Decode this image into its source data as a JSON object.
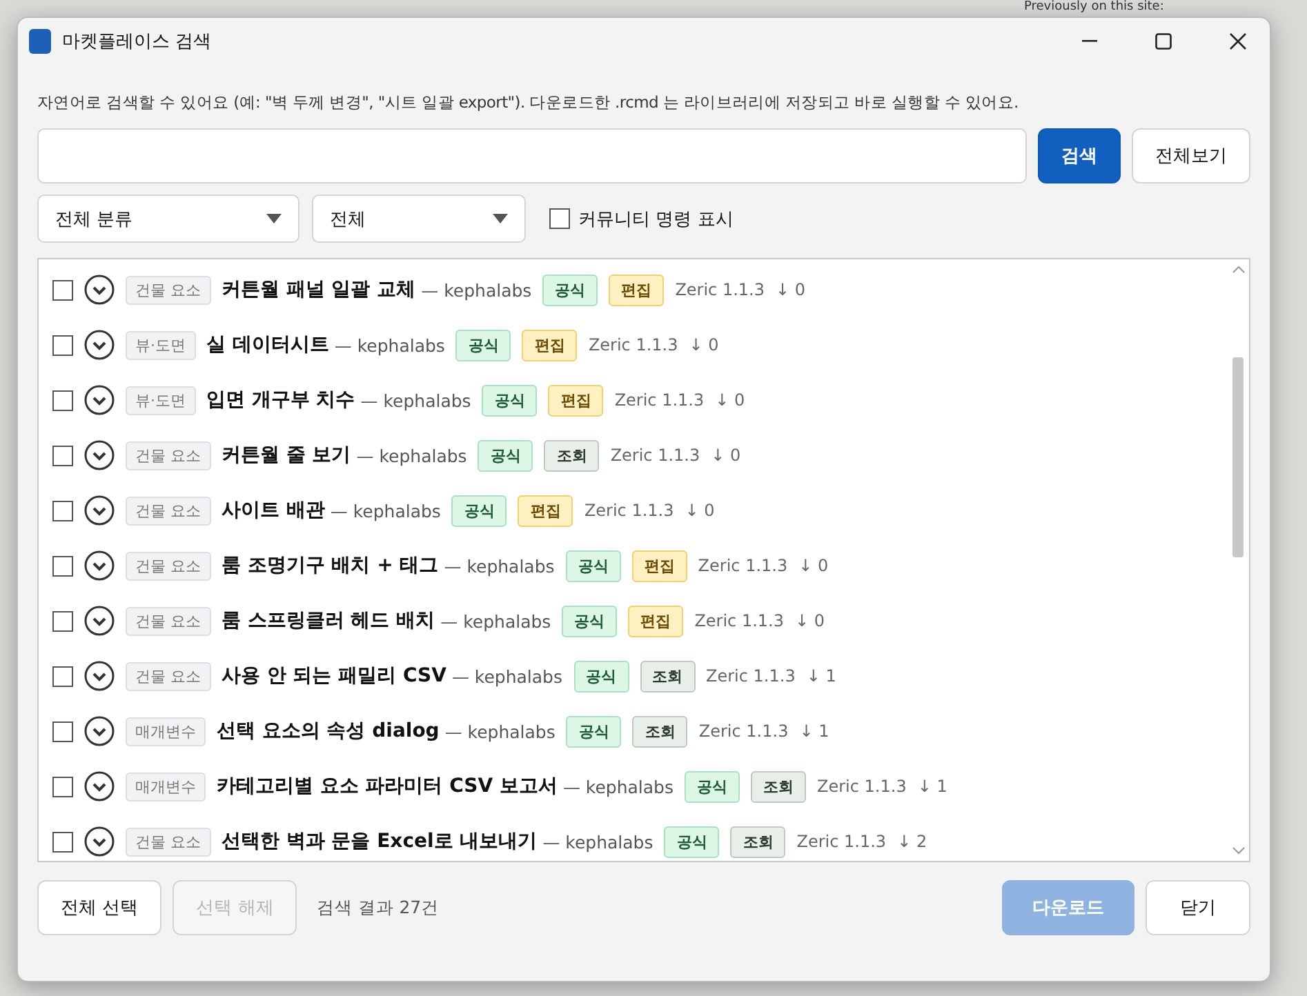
{
  "background": {
    "caption": "Previously on this site:"
  },
  "window": {
    "title": "마켓플레이스 검색"
  },
  "description": "자연어로 검색할 수 있어요 (예: \"벽 두께 변경\", \"시트 일괄 export\"). 다운로드한 .rcmd 는 라이브러리에 저장되고 바로 실행할 수 있어요.",
  "search": {
    "button": "검색",
    "show_all": "전체보기"
  },
  "filters": {
    "category": "전체 분류",
    "scope": "전체",
    "community": {
      "label": "커뮤니티 명령 표시",
      "checked": false
    }
  },
  "results": [
    {
      "checked": false,
      "category": "건물 요소",
      "title": "커튼월 패널 일괄 교체",
      "author": "— kephalabs",
      "tags": [
        {
          "label": "공식",
          "kind": "official"
        },
        {
          "label": "편집",
          "kind": "edit"
        }
      ],
      "version": "Zeric 1.1.3",
      "downloads": "↓ 0"
    },
    {
      "checked": false,
      "category": "뷰·도면",
      "title": "실 데이터시트",
      "author": "— kephalabs",
      "tags": [
        {
          "label": "공식",
          "kind": "official"
        },
        {
          "label": "편집",
          "kind": "edit"
        }
      ],
      "version": "Zeric 1.1.3",
      "downloads": "↓ 0"
    },
    {
      "checked": false,
      "category": "뷰·도면",
      "title": "입면 개구부 치수",
      "author": "— kephalabs",
      "tags": [
        {
          "label": "공식",
          "kind": "official"
        },
        {
          "label": "편집",
          "kind": "edit"
        }
      ],
      "version": "Zeric 1.1.3",
      "downloads": "↓ 0"
    },
    {
      "checked": false,
      "category": "건물 요소",
      "title": "커튼월 줄 보기",
      "author": "— kephalabs",
      "tags": [
        {
          "label": "공식",
          "kind": "official"
        },
        {
          "label": "조회",
          "kind": "view"
        }
      ],
      "version": "Zeric 1.1.3",
      "downloads": "↓ 0"
    },
    {
      "checked": false,
      "category": "건물 요소",
      "title": "사이트 배관",
      "author": "— kephalabs",
      "tags": [
        {
          "label": "공식",
          "kind": "official"
        },
        {
          "label": "편집",
          "kind": "edit"
        }
      ],
      "version": "Zeric 1.1.3",
      "downloads": "↓ 0"
    },
    {
      "checked": false,
      "category": "건물 요소",
      "title": "룸 조명기구 배치 + 태그",
      "author": "— kephalabs",
      "tags": [
        {
          "label": "공식",
          "kind": "official"
        },
        {
          "label": "편집",
          "kind": "edit"
        }
      ],
      "version": "Zeric 1.1.3",
      "downloads": "↓ 0"
    },
    {
      "checked": false,
      "category": "건물 요소",
      "title": "룸 스프링클러 헤드 배치",
      "author": "— kephalabs",
      "tags": [
        {
          "label": "공식",
          "kind": "official"
        },
        {
          "label": "편집",
          "kind": "edit"
        }
      ],
      "version": "Zeric 1.1.3",
      "downloads": "↓ 0"
    },
    {
      "checked": false,
      "category": "건물 요소",
      "title": "사용 안 되는 패밀리 CSV",
      "author": "— kephalabs",
      "tags": [
        {
          "label": "공식",
          "kind": "official"
        },
        {
          "label": "조회",
          "kind": "view"
        }
      ],
      "version": "Zeric 1.1.3",
      "downloads": "↓ 1"
    },
    {
      "checked": false,
      "category": "매개변수",
      "title": "선택 요소의 속성 dialog",
      "author": "— kephalabs",
      "tags": [
        {
          "label": "공식",
          "kind": "official"
        },
        {
          "label": "조회",
          "kind": "view"
        }
      ],
      "version": "Zeric 1.1.3",
      "downloads": "↓ 1"
    },
    {
      "checked": false,
      "category": "매개변수",
      "title": "카테고리별 요소 파라미터 CSV 보고서",
      "author": "— kephalabs",
      "tags": [
        {
          "label": "공식",
          "kind": "official"
        },
        {
          "label": "조회",
          "kind": "view"
        }
      ],
      "version": "Zeric 1.1.3",
      "downloads": "↓ 1"
    },
    {
      "checked": false,
      "category": "건물 요소",
      "title": "선택한 벽과 문을 Excel로 내보내기",
      "author": "— kephalabs",
      "tags": [
        {
          "label": "공식",
          "kind": "official"
        },
        {
          "label": "조회",
          "kind": "view"
        }
      ],
      "version": "Zeric 1.1.3",
      "downloads": "↓ 2"
    }
  ],
  "footer": {
    "select_all": {
      "label": "전체 선택",
      "disabled": false
    },
    "deselect": {
      "label": "선택 해제",
      "disabled": true
    },
    "count": "검색 결과 27건",
    "download": {
      "label": "다운로드",
      "disabled": true
    },
    "close": {
      "label": "닫기",
      "disabled": false
    }
  }
}
